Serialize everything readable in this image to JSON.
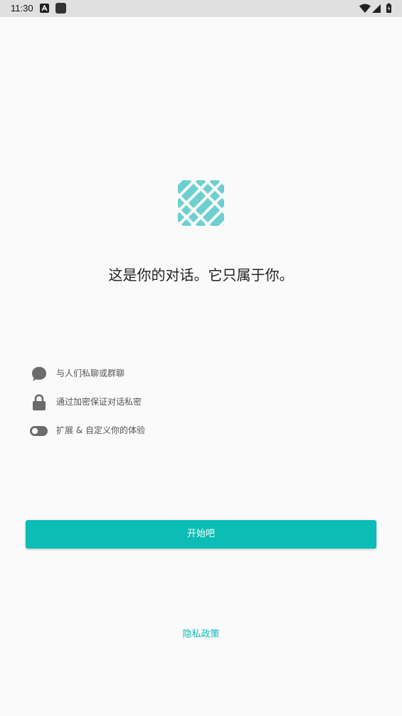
{
  "status_bar": {
    "time": "11:30",
    "icons": [
      "app-icon-a",
      "app-icon-square",
      "wifi-icon",
      "signal-icon",
      "battery-icon"
    ]
  },
  "welcome": {
    "logo": "woven-pattern-logo",
    "headline": "这是你的对话。它只属于你。"
  },
  "features": [
    {
      "icon": "chat-bubble-icon",
      "text": "与人们私聊或群聊"
    },
    {
      "icon": "lock-icon",
      "text": "通过加密保证对话私密"
    },
    {
      "icon": "toggle-icon",
      "text": "扩展 & 自定义你的体验"
    }
  ],
  "actions": {
    "start_label": "开始吧",
    "privacy_label": "隐私政策"
  },
  "colors": {
    "accent": "#0bbdb4",
    "logo": "#6bd0cf",
    "icon_gray": "#6b6b6b",
    "background": "#fafafa"
  }
}
